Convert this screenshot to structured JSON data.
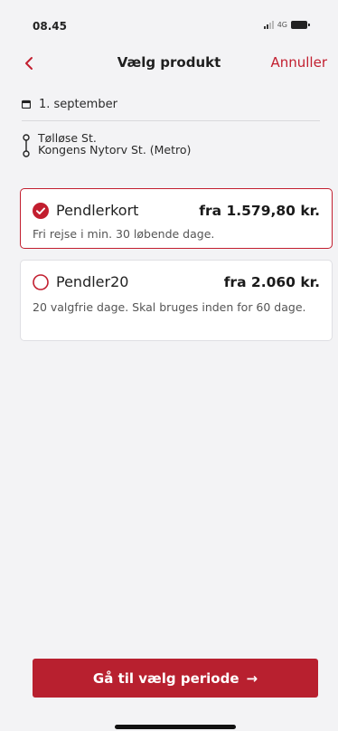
{
  "status_bar": {
    "time": "08.45",
    "network": "4G"
  },
  "nav": {
    "title": "Vælg produkt",
    "cancel_label": "Annuller",
    "back_icon": "chevron-left-icon"
  },
  "journey": {
    "date": "1. september",
    "from": "Tølløse St.",
    "to": "Kongens Nytorv St. (Metro)"
  },
  "products": [
    {
      "name": "Pendlerkort",
      "price": "fra 1.579,80 kr.",
      "description": "Fri rejse i min. 30 løbende dage.",
      "selected": true
    },
    {
      "name": "Pendler20",
      "price": "fra 2.060 kr.",
      "description": "20 valgfrie dage. Skal bruges inden for 60 dage.",
      "selected": false
    }
  ],
  "cta": {
    "label": "Gå til vælg periode",
    "arrow": "→"
  },
  "colors": {
    "accent": "#c21e2f",
    "button": "#b8202f",
    "background": "#f3f3f5"
  }
}
